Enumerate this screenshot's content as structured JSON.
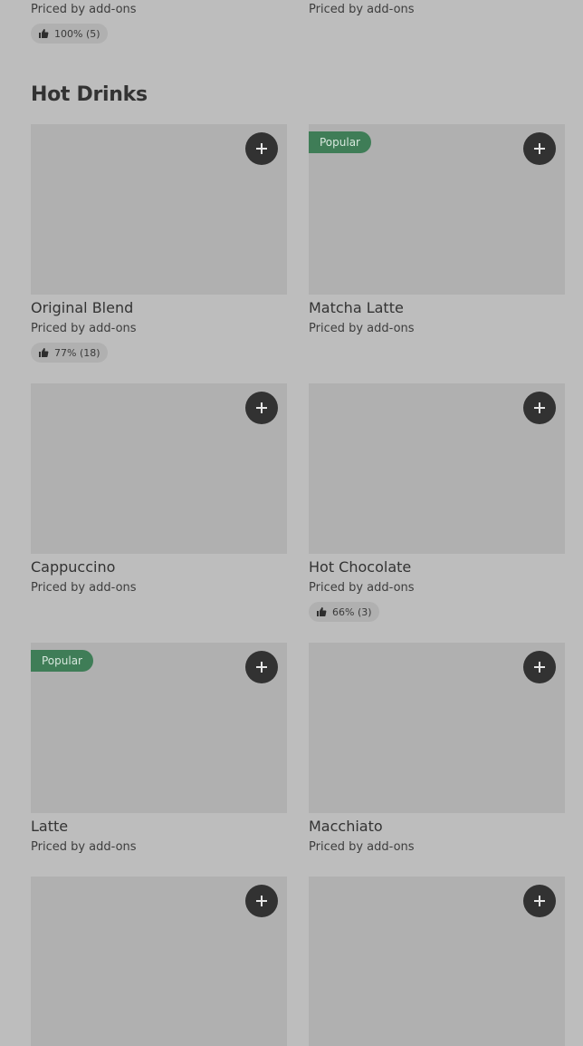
{
  "top_row": {
    "left": {
      "price": "Priced by add-ons",
      "rating": "100% (5)"
    },
    "right": {
      "price": "Priced by add-ons"
    }
  },
  "section": {
    "title": "Hot Drinks",
    "items": [
      {
        "name": "Original Blend",
        "price": "Priced by add-ons",
        "rating": "77% (18)"
      },
      {
        "name": "Matcha Latte",
        "price": "Priced by add-ons",
        "badge": "Popular"
      },
      {
        "name": "Cappuccino",
        "price": "Priced by add-ons"
      },
      {
        "name": "Hot Chocolate",
        "price": "Priced by add-ons",
        "rating": "66% (3)"
      },
      {
        "name": "Latte",
        "price": "Priced by add-ons",
        "badge": "Popular"
      },
      {
        "name": "Macchiato",
        "price": "Priced by add-ons"
      },
      {},
      {}
    ]
  },
  "icons": {
    "add": "plus-icon",
    "rating": "thumbs-up-icon"
  },
  "colors": {
    "background": "#bdbdbd",
    "thumbnail": "#b0b0b0",
    "add_button": "#323232",
    "popular_badge": "#3f7d57"
  }
}
